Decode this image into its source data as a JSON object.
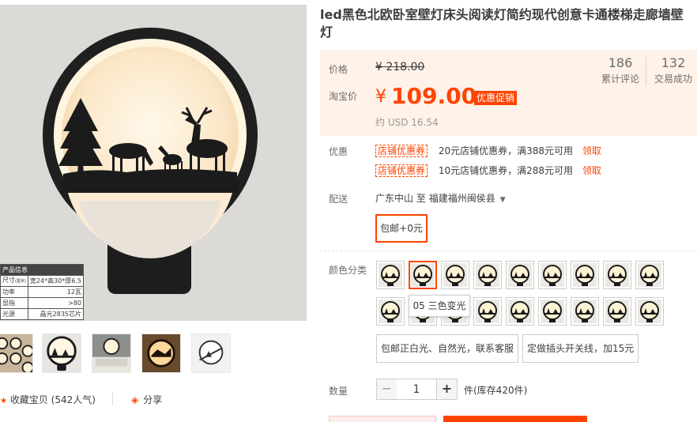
{
  "product": {
    "title": "led黑色北欧卧室壁灯床头阅读灯简约现代创意卡通楼梯走廊墙壁灯"
  },
  "gallery": {
    "spec_table": {
      "header": "产品信息",
      "rows": [
        {
          "key": "尺寸",
          "key_note": "(厘米)",
          "value": "宽24*高30*厚6.5"
        },
        {
          "key": "功率",
          "value": "12瓦"
        },
        {
          "key": "显指",
          "value": ">80"
        },
        {
          "key": "光源",
          "value": "晶元2835芯片"
        }
      ]
    },
    "favorite": {
      "label": "收藏宝贝",
      "count": "(542人气)"
    },
    "share_label": "分享"
  },
  "pricing": {
    "original_label": "价格",
    "original_price": "¥ 218.00",
    "tb_label": "淘宝价",
    "currency": "¥",
    "price": "109.00",
    "promo_tag": "优惠促销",
    "usd": "约 USD 16.54",
    "stats": [
      {
        "count": "186",
        "label": "累计评论"
      },
      {
        "count": "132",
        "label": "交易成功"
      }
    ]
  },
  "discount": {
    "label": "优惠",
    "coupons": [
      {
        "tag": "店铺优惠券",
        "desc": "20元店铺优惠券，满388元可用",
        "action": "领取"
      },
      {
        "tag": "店铺优惠券",
        "desc": "10元店铺优惠券，满288元可用",
        "action": "领取"
      }
    ]
  },
  "shipping": {
    "label": "配送",
    "from": "广东中山",
    "to_word": "至",
    "to": "福建福州闽侯县",
    "fee": "包邮+0元"
  },
  "color": {
    "label": "颜色分类",
    "tooltip": "05 三色变光",
    "options": [
      "包邮正白光、自然光，联系客服",
      "定做插头开关线，加15元"
    ]
  },
  "quantity": {
    "label": "数量",
    "value": "1",
    "dec": "−",
    "inc": "+",
    "unit": "件(库存420件)"
  },
  "colors": {
    "accent": "#ff4400",
    "price_bg": "#fff2e8"
  }
}
